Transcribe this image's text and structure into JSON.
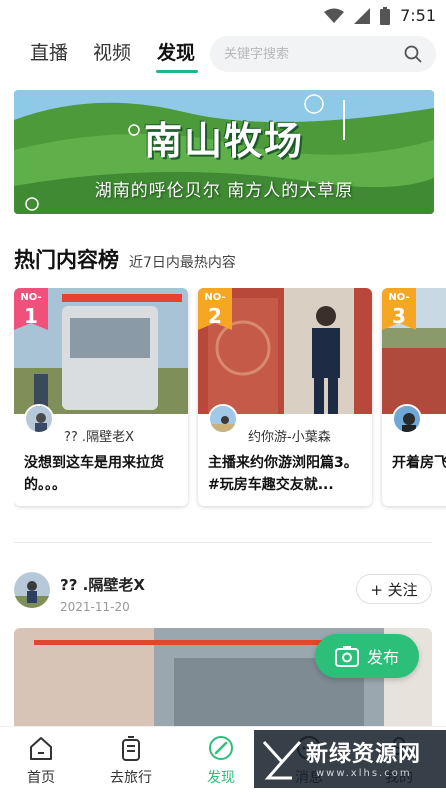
{
  "status_bar": {
    "time": "7:51"
  },
  "top_nav": {
    "tabs": [
      {
        "label": "直播"
      },
      {
        "label": "视频"
      },
      {
        "label": "发现"
      }
    ],
    "search_placeholder": "关键字搜索"
  },
  "banner": {
    "title": "南山牧场",
    "subtitle": "湖南的呼伦贝尔 南方人的大草原"
  },
  "hot": {
    "title": "热门内容榜",
    "subtitle": "近7日内最热内容",
    "items": [
      {
        "no": "NO-",
        "rank": "1",
        "author": "?? .隔壁老X",
        "text": "没想到这车是用来拉货的。。。",
        "badge_color": "#f0517a"
      },
      {
        "no": "NO-",
        "rank": "2",
        "author": "约你游-小葉森",
        "text": "主播来约你游浏阳篇3。#玩房车趣交友就...",
        "badge_color": "#f5a623"
      },
      {
        "no": "NO-",
        "rank": "3",
        "author": "",
        "text": "开着房飞个能",
        "badge_color": "#f5a623"
      }
    ]
  },
  "post": {
    "user": "?? .隔壁老X",
    "date": "2021-11-20",
    "follow_label": "+ 关注"
  },
  "publish": {
    "label": "发布"
  },
  "bottom_nav": {
    "items": [
      {
        "label": "首页"
      },
      {
        "label": "去旅行"
      },
      {
        "label": "发现"
      },
      {
        "label": "消息"
      },
      {
        "label": "我的"
      }
    ]
  },
  "watermark": {
    "text": "新绿资源网",
    "url": "www.xlhs.com"
  },
  "colors": {
    "accent": "#2cbf7a",
    "underline": "#1fb58f"
  }
}
